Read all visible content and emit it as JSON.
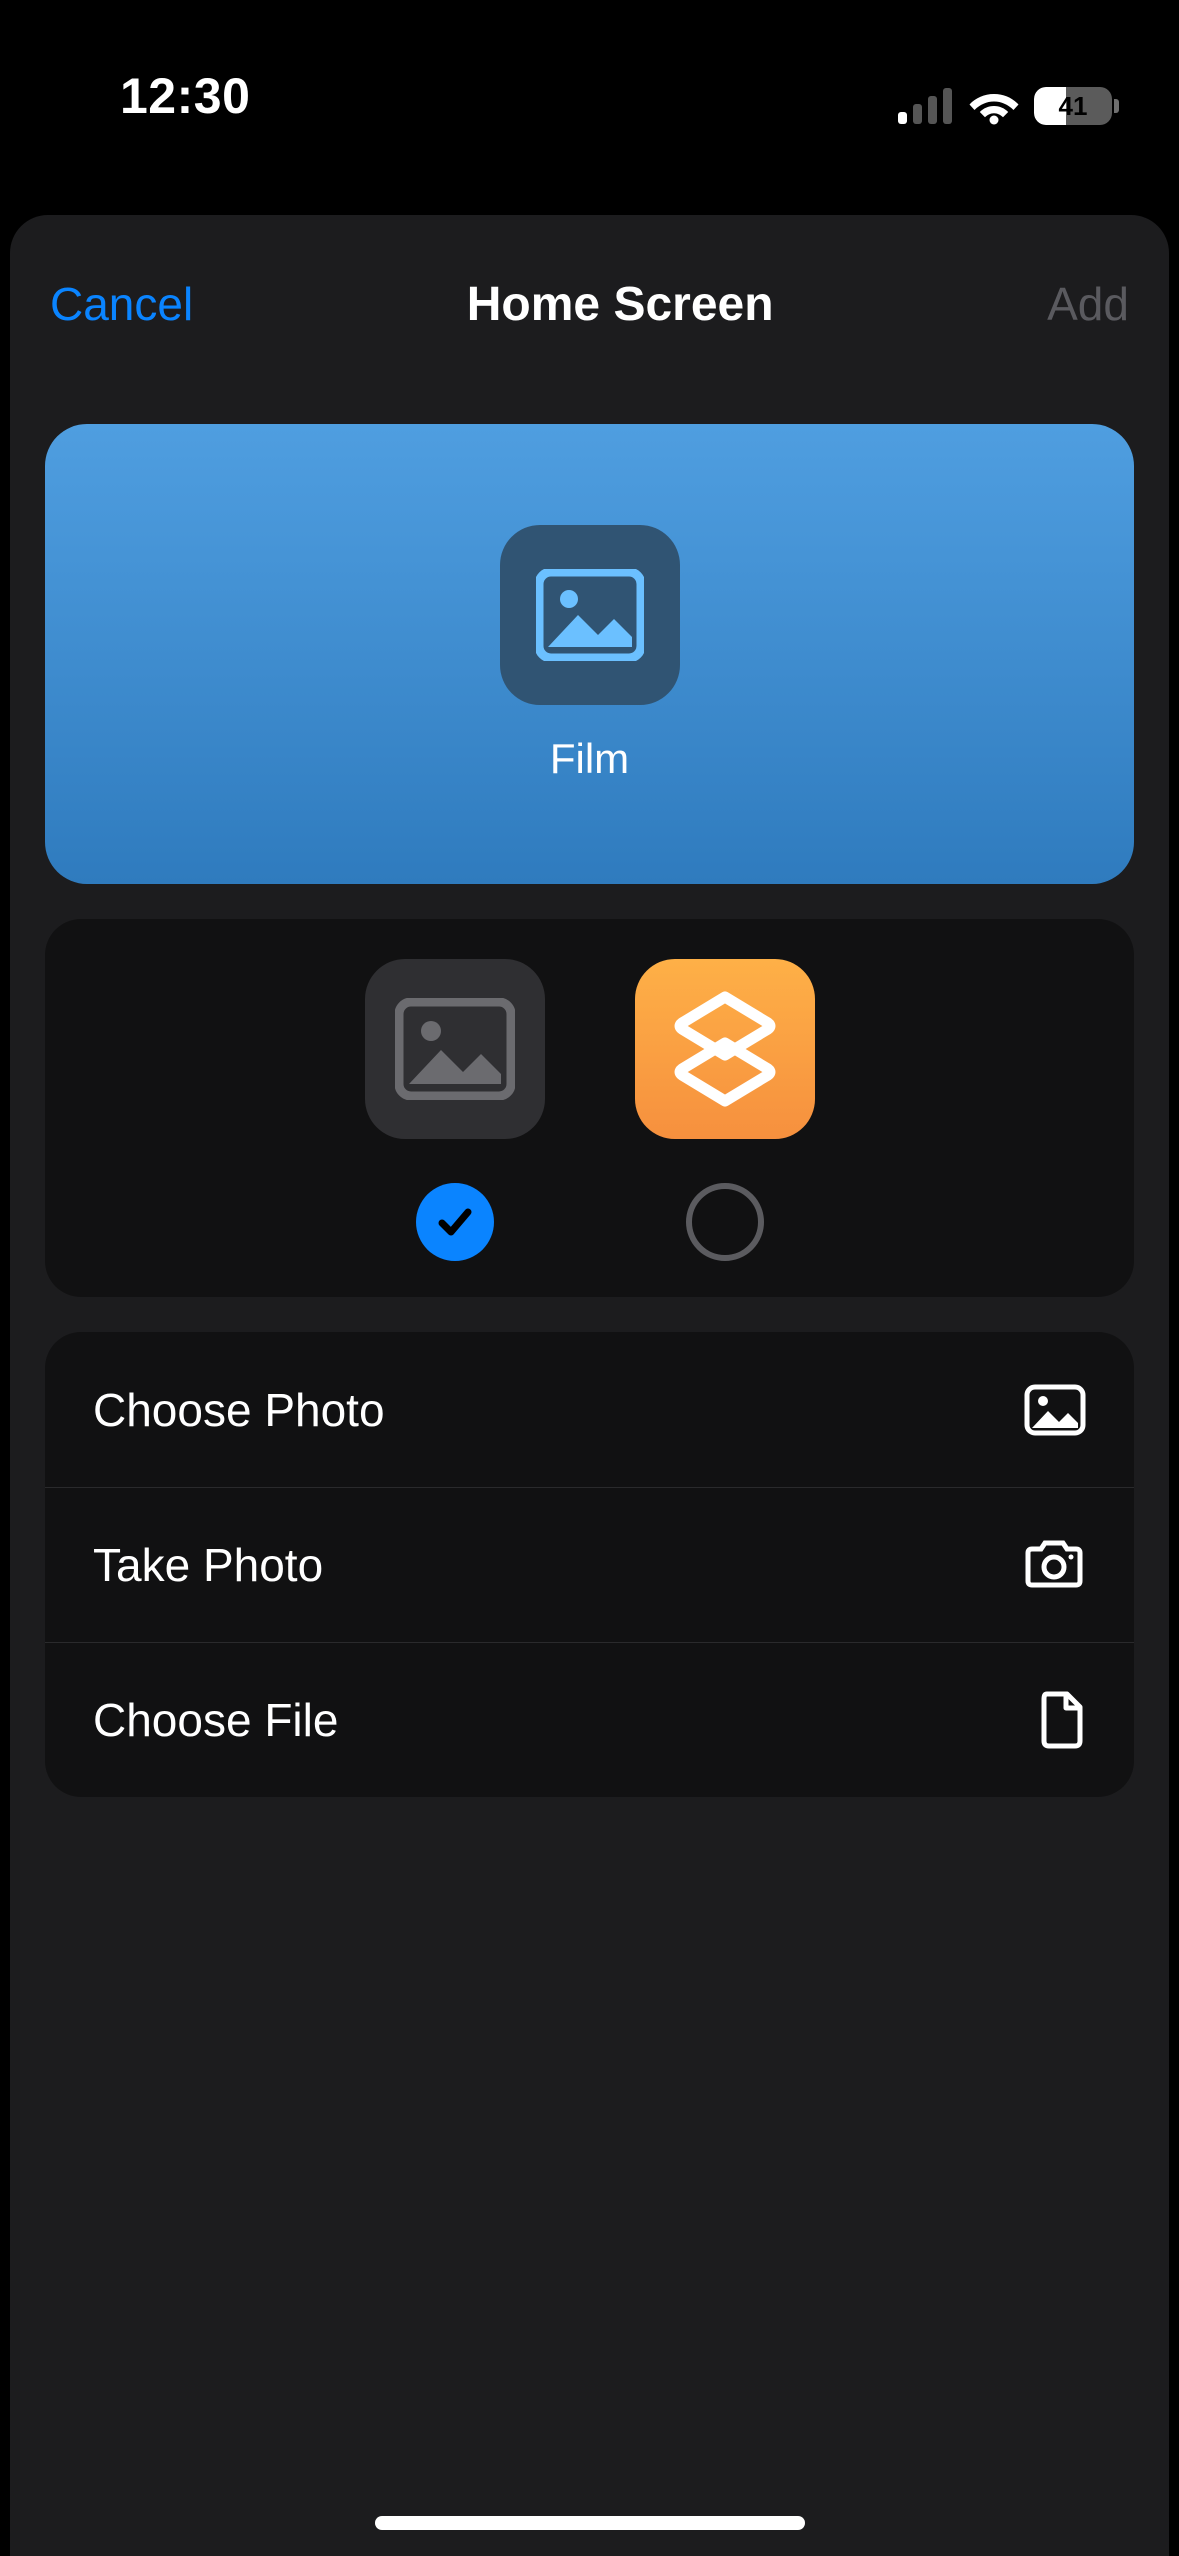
{
  "status": {
    "time": "12:30",
    "battery": "41"
  },
  "sheet": {
    "cancel": "Cancel",
    "title": "Home Screen",
    "add": "Add"
  },
  "preview": {
    "label": "Film"
  },
  "actions": {
    "choose_photo": "Choose Photo",
    "take_photo": "Take Photo",
    "choose_file": "Choose File"
  }
}
